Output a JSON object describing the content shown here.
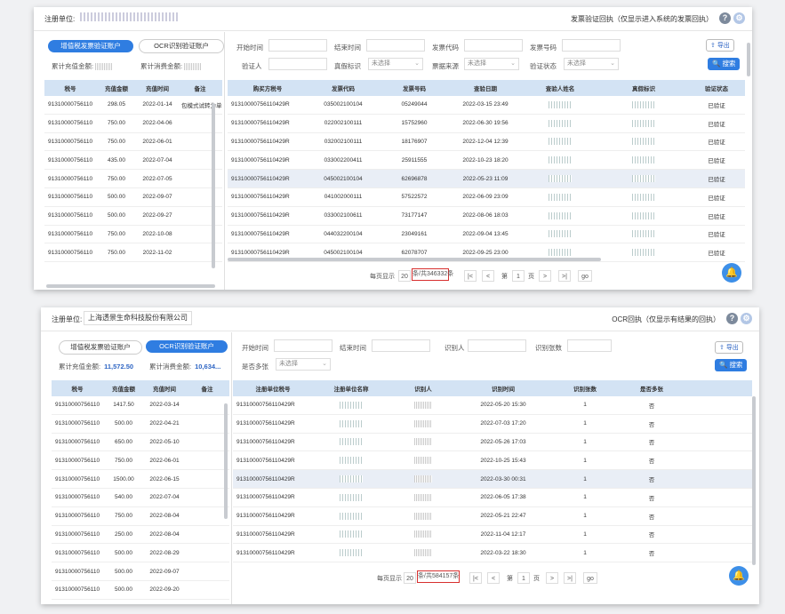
{
  "p1": {
    "unit_label": "注册单位:",
    "title": "发票验证回执（仅显示进入系统的发票回执）",
    "help_icon": "?",
    "tabs": [
      {
        "label": "增值税发票验证账户"
      },
      {
        "label": "OCR识别验证账户"
      }
    ],
    "stat_recharge_label": "累计充值金额:",
    "stat_consume_label": "累计消费金额:",
    "filters": {
      "start_time": "开始时间",
      "end_time": "结束时间",
      "invoice_code": "发票代码",
      "invoice_number": "发票号码",
      "verifier": "验证人",
      "authenticity": "真假标识",
      "invoice_source": "票据来源",
      "verify_status": "验证状态",
      "unselected": "未选择"
    },
    "export_label": "导出",
    "search_label": "搜索",
    "left_headers": [
      "税号",
      "充值金额",
      "充值时间",
      "备注"
    ],
    "left_rows": [
      [
        "91310000756110",
        "298.05",
        "2022-01-14",
        "包模式试转为单"
      ],
      [
        "91310000756110",
        "750.00",
        "2022-04-06",
        ""
      ],
      [
        "91310000756110",
        "750.00",
        "2022-06-01",
        ""
      ],
      [
        "91310000756110",
        "435.00",
        "2022-07-04",
        ""
      ],
      [
        "91310000756110",
        "750.00",
        "2022-07-05",
        ""
      ],
      [
        "91310000756110",
        "500.00",
        "2022-09-07",
        ""
      ],
      [
        "91310000756110",
        "500.00",
        "2022-09-27",
        ""
      ],
      [
        "91310000756110",
        "750.00",
        "2022-10-08",
        ""
      ],
      [
        "91310000756110",
        "750.00",
        "2022-11-02",
        ""
      ]
    ],
    "right_headers": [
      "购买方税号",
      "发票代码",
      "发票号码",
      "查验日期",
      "查验人姓名",
      "真假标识",
      "验证状态"
    ],
    "right_rows": [
      [
        "91310000756110429R",
        "035002100104",
        "05249044",
        "2022-03-15 23:49",
        "已验证"
      ],
      [
        "91310000756110429R",
        "022002100111",
        "15752960",
        "2022-06-30 19:56",
        "已验证"
      ],
      [
        "91310000756110429R",
        "032002100111",
        "18176907",
        "2022-12-04 12:39",
        "已验证"
      ],
      [
        "91310000756110429R",
        "033002200411",
        "25911555",
        "2022-10-23 18:20",
        "已验证"
      ],
      [
        "91310000756110429R",
        "045002100104",
        "62696878",
        "2022-05-23 11:09",
        "已验证"
      ],
      [
        "91310000756110429R",
        "041002000111",
        "57522572",
        "2022-06-09 23:09",
        "已验证"
      ],
      [
        "91310000756110429R",
        "033002100611",
        "73177147",
        "2022-08-06 18:03",
        "已验证"
      ],
      [
        "91310000756110429R",
        "044032200104",
        "23049161",
        "2022-09-04 13:45",
        "已验证"
      ],
      [
        "91310000756110429R",
        "045002100104",
        "62078707",
        "2022-09-25 23:00",
        "已验证"
      ]
    ],
    "pager": {
      "per_page_label": "每页显示",
      "per_page": "20",
      "total": "条/共346332条",
      "first": "|<",
      "prev": "<",
      "page_prefix": "第",
      "page": "1",
      "page_suffix": "页",
      "next": ">",
      "last": ">|",
      "go": "go"
    }
  },
  "p2": {
    "unit_label": "注册单位:",
    "unit_name": "上海透景生命科技股份有限公司",
    "title": "OCR回执（仅显示有结果的回执）",
    "help_icon": "?",
    "tabs": [
      {
        "label": "增值税发票验证账户"
      },
      {
        "label": "OCR识别验证账户"
      }
    ],
    "stat_recharge_label": "累计充值金额:",
    "stat_recharge_value": "11,572.50",
    "stat_consume_label": "累计消费金额:",
    "stat_consume_value": "10,634...",
    "filters": {
      "start_time": "开始时间",
      "end_time": "结束时间",
      "recognizer": "识别人",
      "recog_count": "识别张数",
      "multi_ticket": "是否多张",
      "unselected": "未选择"
    },
    "export_label": "导出",
    "search_label": "搜索",
    "left_headers": [
      "税号",
      "充值金额",
      "充值时间",
      "备注"
    ],
    "left_rows": [
      [
        "91310000756110",
        "1417.50",
        "2022-03-14",
        ""
      ],
      [
        "91310000756110",
        "500.00",
        "2022-04-21",
        ""
      ],
      [
        "91310000756110",
        "650.00",
        "2022-05-10",
        ""
      ],
      [
        "91310000756110",
        "750.00",
        "2022-06-01",
        ""
      ],
      [
        "91310000756110",
        "1500.00",
        "2022-06-15",
        ""
      ],
      [
        "91310000756110",
        "540.00",
        "2022-07-04",
        ""
      ],
      [
        "91310000756110",
        "750.00",
        "2022-08-04",
        ""
      ],
      [
        "91310000756110",
        "250.00",
        "2022-08-04",
        ""
      ],
      [
        "91310000756110",
        "500.00",
        "2022-08-29",
        ""
      ],
      [
        "91310000756110",
        "500.00",
        "2022-09-07",
        ""
      ],
      [
        "91310000756110",
        "500.00",
        "2022-09-20",
        ""
      ]
    ],
    "right_headers": [
      "注册单位税号",
      "注册单位名称",
      "识别人",
      "识别时间",
      "识别张数",
      "是否多张"
    ],
    "right_rows": [
      [
        "91310000756110429R",
        "2022-05-20 15:30",
        "1",
        "否"
      ],
      [
        "91310000756110429R",
        "2022-07-03 17:20",
        "1",
        "否"
      ],
      [
        "91310000756110429R",
        "2022-05-26 17:03",
        "1",
        "否"
      ],
      [
        "91310000756110429R",
        "2022-10-25 15:43",
        "1",
        "否"
      ],
      [
        "91310000756110429R",
        "2022-03-30 00:31",
        "1",
        "否"
      ],
      [
        "91310000756110429R",
        "2022-06-05 17:38",
        "1",
        "否"
      ],
      [
        "91310000756110429R",
        "2022-05-21 22:47",
        "1",
        "否"
      ],
      [
        "91310000756110429R",
        "2022-11-04 12:17",
        "1",
        "否"
      ],
      [
        "91310000756110429R",
        "2022-03-22 18:30",
        "1",
        "否"
      ]
    ],
    "pager": {
      "per_page_label": "每页显示",
      "per_page": "20",
      "total": "条/共584157条",
      "first": "|<",
      "prev": "<",
      "page_prefix": "第",
      "page": "1",
      "page_suffix": "页",
      "next": ">",
      "last": ">|",
      "go": "go"
    }
  }
}
